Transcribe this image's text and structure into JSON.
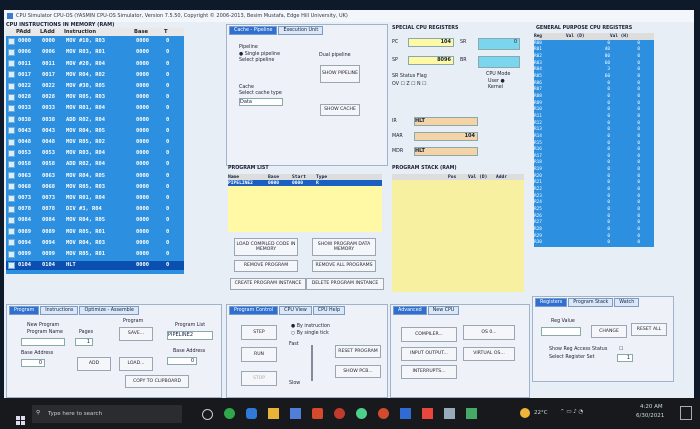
{
  "window": {
    "title": "CPU Simulator CPU-OS  (YASMIN CPU-OS Simulator, Version 7.5.50, Copyright © 2006-2013, Besim Mustafa, Edge Hill University, UK)"
  },
  "memory": {
    "title": "CPU INSTRUCTIONS IN MEMORY (RAM)",
    "columns": [
      "PAdd",
      "LAdd",
      "Instruction",
      "Base",
      "T"
    ],
    "rows": [
      {
        "padd": "0000",
        "ladd": "0000",
        "instr": "MOV #10, R03",
        "base": "0000",
        "t": "0"
      },
      {
        "padd": "0006",
        "ladd": "0006",
        "instr": "MOV R03, R01",
        "base": "0000",
        "t": "0"
      },
      {
        "padd": "0011",
        "ladd": "0011",
        "instr": "MOV #20, R04",
        "base": "0000",
        "t": "0"
      },
      {
        "padd": "0017",
        "ladd": "0017",
        "instr": "MOV R04, R02",
        "base": "0000",
        "t": "0"
      },
      {
        "padd": "0022",
        "ladd": "0022",
        "instr": "MOV #30, R05",
        "base": "0000",
        "t": "0"
      },
      {
        "padd": "0028",
        "ladd": "0028",
        "instr": "MOV R05, R03",
        "base": "0000",
        "t": "0"
      },
      {
        "padd": "0033",
        "ladd": "0033",
        "instr": "MOV R01, R04",
        "base": "0000",
        "t": "0"
      },
      {
        "padd": "0038",
        "ladd": "0038",
        "instr": "ADD R02, R04",
        "base": "0000",
        "t": "0"
      },
      {
        "padd": "0043",
        "ladd": "0043",
        "instr": "MOV R04, R05",
        "base": "0000",
        "t": "0"
      },
      {
        "padd": "0048",
        "ladd": "0048",
        "instr": "MOV R05, R02",
        "base": "0000",
        "t": "0"
      },
      {
        "padd": "0053",
        "ladd": "0053",
        "instr": "MOV R03, R04",
        "base": "0000",
        "t": "0"
      },
      {
        "padd": "0058",
        "ladd": "0058",
        "instr": "ADD R02, R04",
        "base": "0000",
        "t": "0"
      },
      {
        "padd": "0063",
        "ladd": "0063",
        "instr": "MOV R04, R05",
        "base": "0000",
        "t": "0"
      },
      {
        "padd": "0068",
        "ladd": "0068",
        "instr": "MOV R05, R03",
        "base": "0000",
        "t": "0"
      },
      {
        "padd": "0073",
        "ladd": "0073",
        "instr": "MOV R01, R04",
        "base": "0000",
        "t": "0"
      },
      {
        "padd": "0078",
        "ladd": "0078",
        "instr": "DIV #3, R04",
        "base": "0000",
        "t": "0"
      },
      {
        "padd": "0084",
        "ladd": "0084",
        "instr": "MOV R04, R05",
        "base": "0000",
        "t": "0"
      },
      {
        "padd": "0089",
        "ladd": "0089",
        "instr": "MOV R05, R01",
        "base": "0000",
        "t": "0"
      },
      {
        "padd": "0094",
        "ladd": "0094",
        "instr": "MOV R04, R03",
        "base": "0000",
        "t": "0"
      },
      {
        "padd": "0099",
        "ladd": "0099",
        "instr": "MOV R05, R01",
        "base": "0000",
        "t": "0"
      },
      {
        "padd": "0104",
        "ladd": "0104",
        "instr": "HLT",
        "base": "0000",
        "t": "0"
      }
    ]
  },
  "pipeline_tabs": [
    "Cache - Pipeline",
    "Execution Unit"
  ],
  "pipeline": {
    "label": "Pipeline",
    "single_pipeline": "Single pipeline",
    "select_pipeline": "Select pipeline",
    "dual_pipeline": "Dual pipeline",
    "show_pipeline": "SHOW PIPELINE",
    "cache_label": "Cache",
    "select_cache_type": "Select cache type",
    "cache_value": "Data",
    "show_cache": "SHOW CACHE"
  },
  "special_registers": {
    "title": "SPECIAL CPU REGISTERS",
    "pc_label": "PC",
    "pc_value": "104",
    "sr_label": "SR",
    "sr_value": "0",
    "sp_label": "SP",
    "sp_value": "8096",
    "bp_label": "BR",
    "bp_value": "",
    "status_label": "SR Status Flag",
    "flags": [
      "OV",
      "Z",
      "N"
    ],
    "mode_label": "CPU Mode",
    "mode_user": "User",
    "mode_kernel": "Kernel",
    "ir_label": "IR",
    "ir_value": "HLT",
    "mar_label": "MAR",
    "mar_value": "104",
    "mdr_label": "MDR",
    "mdr_value": "HLT"
  },
  "program_list": {
    "title": "PROGRAM LIST",
    "columns": [
      "Name",
      "Base",
      "Start",
      "Type"
    ],
    "row": {
      "name": "PIPELINE2",
      "base": "0000",
      "start": "0000",
      "type": "R"
    },
    "load_compiled": "LOAD COMPILED CODE IN MEMORY",
    "show_program_data": "SHOW PROGRAM DATA MEMORY",
    "remove_program": "REMOVE PROGRAM",
    "remove_all": "REMOVE ALL PROGRAMS",
    "create_instance": "CREATE PROGRAM INSTANCE",
    "delete_instance": "DELETE PROGRAM INSTANCE"
  },
  "program_stack": {
    "title": "PROGRAM STACK (RAM)",
    "columns": [
      "Pos",
      "Val (D)",
      "Addr"
    ]
  },
  "gp_registers": {
    "title": "GENERAL PURPOSE CPU REGISTERS",
    "columns": [
      "Reg",
      "Val (D)",
      "Val (H)"
    ],
    "rows": [
      {
        "r": "R00",
        "d": "0",
        "h": "0"
      },
      {
        "r": "R01",
        "d": "40",
        "h": "0"
      },
      {
        "r": "R02",
        "d": "80",
        "h": "0"
      },
      {
        "r": "R03",
        "d": "60",
        "h": "0"
      },
      {
        "r": "R04",
        "d": "3",
        "h": "0"
      },
      {
        "r": "R05",
        "d": "60",
        "h": "0"
      },
      {
        "r": "R06",
        "d": "0",
        "h": "0"
      },
      {
        "r": "R07",
        "d": "0",
        "h": "0"
      },
      {
        "r": "R08",
        "d": "0",
        "h": "0"
      },
      {
        "r": "R09",
        "d": "0",
        "h": "0"
      },
      {
        "r": "R10",
        "d": "0",
        "h": "0"
      },
      {
        "r": "R11",
        "d": "0",
        "h": "0"
      },
      {
        "r": "R12",
        "d": "0",
        "h": "0"
      },
      {
        "r": "R13",
        "d": "0",
        "h": "0"
      },
      {
        "r": "R14",
        "d": "0",
        "h": "0"
      },
      {
        "r": "R15",
        "d": "0",
        "h": "0"
      },
      {
        "r": "R16",
        "d": "0",
        "h": "0"
      },
      {
        "r": "R17",
        "d": "0",
        "h": "0"
      },
      {
        "r": "R18",
        "d": "0",
        "h": "0"
      },
      {
        "r": "R19",
        "d": "0",
        "h": "0"
      },
      {
        "r": "R20",
        "d": "0",
        "h": "0"
      },
      {
        "r": "R21",
        "d": "0",
        "h": "0"
      },
      {
        "r": "R22",
        "d": "0",
        "h": "0"
      },
      {
        "r": "R23",
        "d": "0",
        "h": "0"
      },
      {
        "r": "R24",
        "d": "0",
        "h": "0"
      },
      {
        "r": "R25",
        "d": "0",
        "h": "0"
      },
      {
        "r": "R26",
        "d": "0",
        "h": "0"
      },
      {
        "r": "R27",
        "d": "0",
        "h": "0"
      },
      {
        "r": "R28",
        "d": "0",
        "h": "0"
      },
      {
        "r": "R29",
        "d": "0",
        "h": "0"
      },
      {
        "r": "R30",
        "d": "0",
        "h": "0"
      }
    ]
  },
  "bottom_left_tabs": [
    "Program",
    "Instructions",
    "Optimize - Assemble"
  ],
  "program_panel": {
    "new_program": "New Program",
    "program_name": "Program Name",
    "pages": "Pages",
    "pages_value": "1",
    "program": "Program",
    "save": "SAVE...",
    "program_list": "Program List",
    "program_list_value": "PIPELINE2",
    "base_address": "Base Address",
    "base_address_value": "0",
    "add": "ADD",
    "load": "LOAD...",
    "base_address2": "Base Address",
    "base_address2_value": "0",
    "copy": "COPY TO CLIPBOARD"
  },
  "bottom_mid_tabs": [
    "Program Control",
    "CPU View",
    "CPU Help"
  ],
  "control": {
    "step": "STEP",
    "by_instruction": "By instruction",
    "by_single_tick": "By single tick",
    "run": "RUN",
    "fast": "Fast",
    "stop": "STOP",
    "slow": "Slow",
    "reset_program": "RESET PROGRAM",
    "show_pcb": "SHOW PCB..."
  },
  "bottom_right_tabs": [
    "Advanced",
    "New CPU"
  ],
  "advanced": {
    "compiler": "COMPILER...",
    "os": "OS 0...",
    "input_output": "INPUT OUTPUT...",
    "virtual_os": "VIRTUAL OS...",
    "interrupts": "INTERRUPTS..."
  },
  "registers_tabs": [
    "Registers",
    "Program Stack",
    "Watch"
  ],
  "registers_panel": {
    "reg_value": "Reg Value",
    "change": "CHANGE",
    "reset_all": "RESET ALL",
    "show_reg_access": "Show Reg Access Status",
    "select_register_set": "Select Register Set",
    "register_set_value": "1"
  },
  "taskbar": {
    "search_placeholder": "Type here to search",
    "weather": "22°C",
    "time": "4:20 AM",
    "date": "6/30/2021"
  }
}
